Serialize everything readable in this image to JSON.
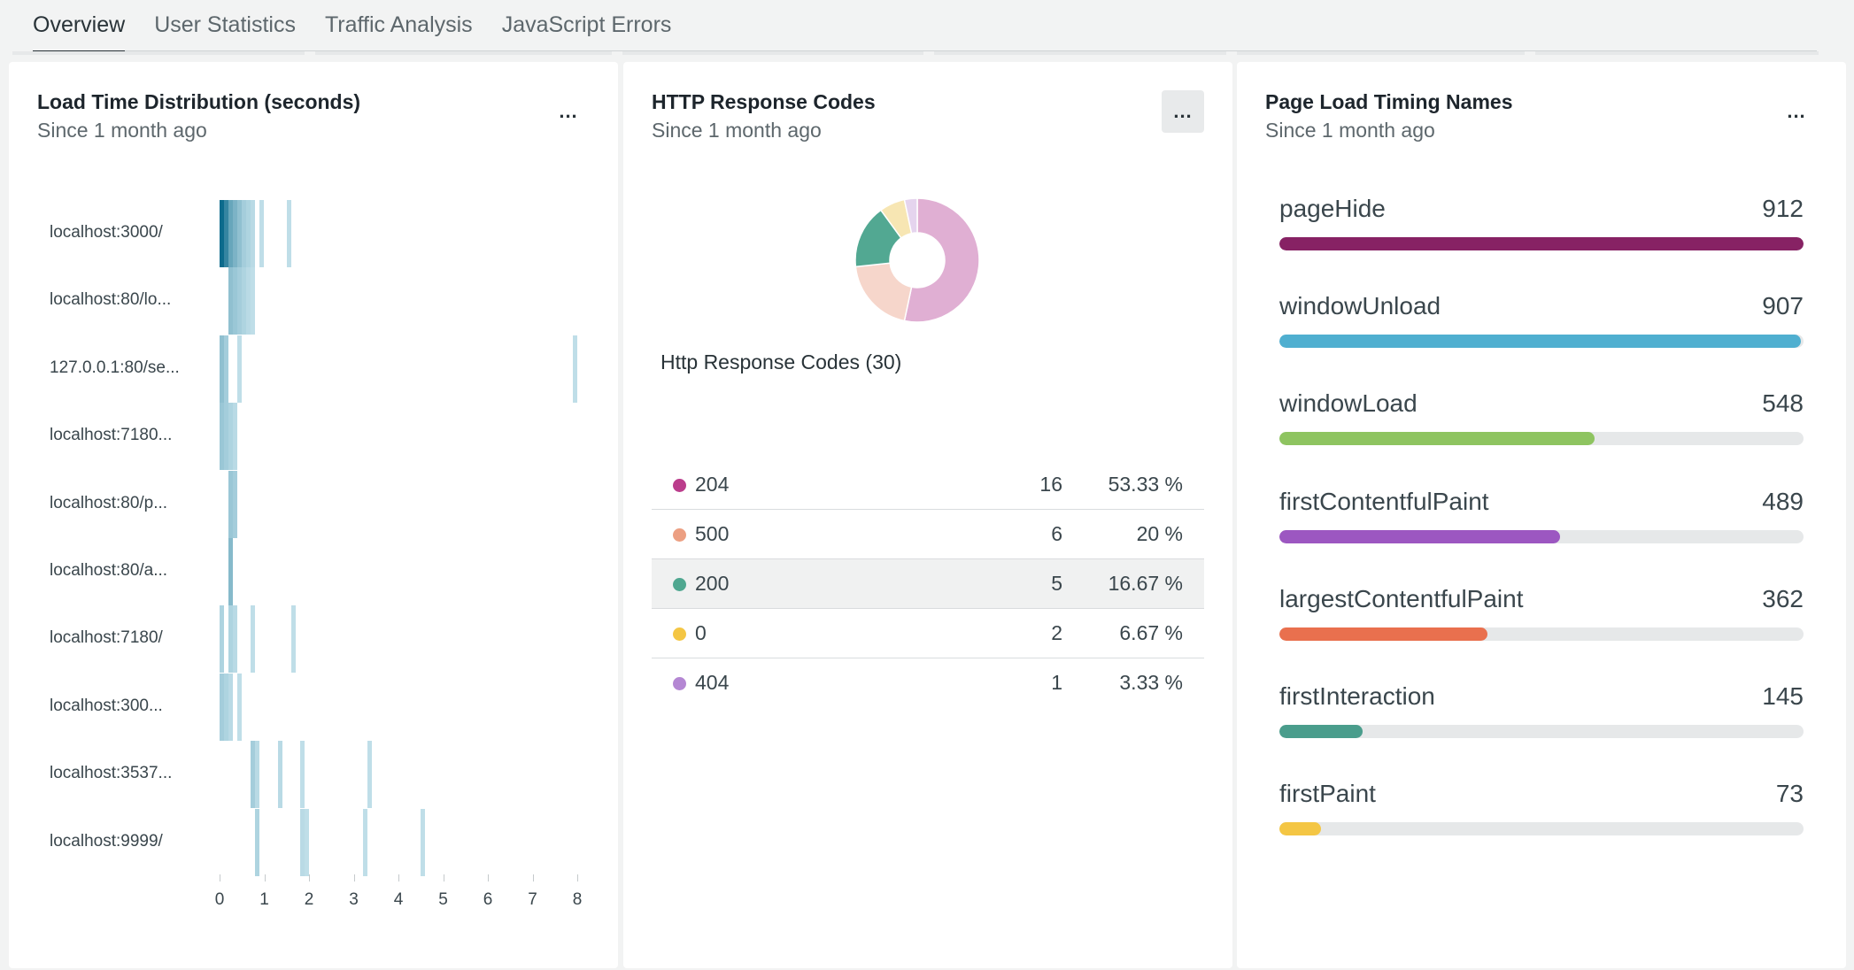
{
  "tabs": [
    {
      "label": "Overview",
      "active": true
    },
    {
      "label": "User Statistics",
      "active": false
    },
    {
      "label": "Traffic Analysis",
      "active": false
    },
    {
      "label": "JavaScript Errors",
      "active": false
    }
  ],
  "cards": {
    "load_time": {
      "title": "Load Time Distribution (seconds)",
      "subtitle": "Since 1 month ago",
      "menu": "..."
    },
    "http_codes": {
      "title": "HTTP Response Codes",
      "subtitle": "Since 1 month ago",
      "menu": "...",
      "legend_title": "Http Response Codes (30)"
    },
    "timing_names": {
      "title": "Page Load Timing Names",
      "subtitle": "Since 1 month ago",
      "menu": "..."
    }
  },
  "chart_data": [
    {
      "type": "heatmap",
      "title": "Load Time Distribution (seconds)",
      "categories": [
        "localhost:3000/",
        "localhost:80/lo...",
        "127.0.0.1:80/se...",
        "localhost:7180...",
        "localhost:80/p...",
        "localhost:80/a...",
        "localhost:7180/",
        "localhost:300...",
        "localhost:3537...",
        "localhost:9999/"
      ],
      "x_ticks": [
        "0",
        "1",
        "2",
        "3",
        "4",
        "5",
        "6",
        "7",
        "8"
      ],
      "xlim": [
        0,
        8
      ],
      "color": "#0c6b8c",
      "cells": [
        [
          [
            0.05,
            1.0
          ],
          [
            0.15,
            0.8
          ],
          [
            0.25,
            0.55
          ],
          [
            0.35,
            0.45
          ],
          [
            0.45,
            0.35
          ],
          [
            0.55,
            0.25
          ],
          [
            0.65,
            0.2
          ],
          [
            0.75,
            0.15
          ],
          [
            0.95,
            0.12
          ],
          [
            1.55,
            0.12
          ]
        ],
        [
          [
            0.25,
            0.35
          ],
          [
            0.35,
            0.3
          ],
          [
            0.45,
            0.25
          ],
          [
            0.55,
            0.2
          ],
          [
            0.65,
            0.15
          ],
          [
            0.75,
            0.12
          ]
        ],
        [
          [
            0.05,
            0.35
          ],
          [
            0.15,
            0.25
          ],
          [
            0.45,
            0.12
          ],
          [
            7.95,
            0.12
          ]
        ],
        [
          [
            0.05,
            0.3
          ],
          [
            0.15,
            0.25
          ],
          [
            0.25,
            0.2
          ],
          [
            0.35,
            0.15
          ]
        ],
        [
          [
            0.25,
            0.3
          ],
          [
            0.35,
            0.25
          ]
        ],
        [
          [
            0.25,
            0.4
          ]
        ],
        [
          [
            0.05,
            0.2
          ],
          [
            0.25,
            0.2
          ],
          [
            0.35,
            0.15
          ],
          [
            0.75,
            0.12
          ],
          [
            1.65,
            0.12
          ]
        ],
        [
          [
            0.05,
            0.25
          ],
          [
            0.15,
            0.2
          ],
          [
            0.25,
            0.15
          ],
          [
            0.45,
            0.12
          ]
        ],
        [
          [
            0.75,
            0.25
          ],
          [
            0.85,
            0.15
          ],
          [
            1.35,
            0.15
          ],
          [
            1.85,
            0.12
          ],
          [
            3.35,
            0.12
          ]
        ],
        [
          [
            0.85,
            0.2
          ],
          [
            1.85,
            0.15
          ],
          [
            1.95,
            0.12
          ],
          [
            3.25,
            0.12
          ],
          [
            4.55,
            0.12
          ]
        ]
      ]
    },
    {
      "type": "pie",
      "title": "HTTP Response Codes",
      "total_label": "Http Response Codes (30)",
      "slices": [
        {
          "name": "204",
          "value": 16,
          "percent": "53.33 %",
          "color": "#e0afd3",
          "dot": "#bb3d8c"
        },
        {
          "name": "500",
          "value": 6,
          "percent": "20 %",
          "color": "#f6d6cb",
          "dot": "#ec9f82"
        },
        {
          "name": "200",
          "value": 5,
          "percent": "16.67 %",
          "color": "#52a892",
          "dot": "#4fa790"
        },
        {
          "name": "0",
          "value": 2,
          "percent": "6.67 %",
          "color": "#f7e6b3",
          "dot": "#f4c644"
        },
        {
          "name": "404",
          "value": 1,
          "percent": "3.33 %",
          "color": "#e5d4ee",
          "dot": "#b487d3"
        }
      ]
    },
    {
      "type": "bar",
      "title": "Page Load Timing Names",
      "ylim": [
        0,
        912
      ],
      "series": [
        {
          "name": "pageHide",
          "value": 912,
          "color": "#872264"
        },
        {
          "name": "windowUnload",
          "value": 907,
          "color": "#4fafd0"
        },
        {
          "name": "windowLoad",
          "value": 548,
          "color": "#8ec460"
        },
        {
          "name": "firstContentfulPaint",
          "value": 489,
          "color": "#9c57c1"
        },
        {
          "name": "largestContentfulPaint",
          "value": 362,
          "color": "#e9704e"
        },
        {
          "name": "firstInteraction",
          "value": 145,
          "color": "#4a9d8c"
        },
        {
          "name": "firstPaint",
          "value": 73,
          "color": "#f4c644"
        }
      ]
    }
  ]
}
